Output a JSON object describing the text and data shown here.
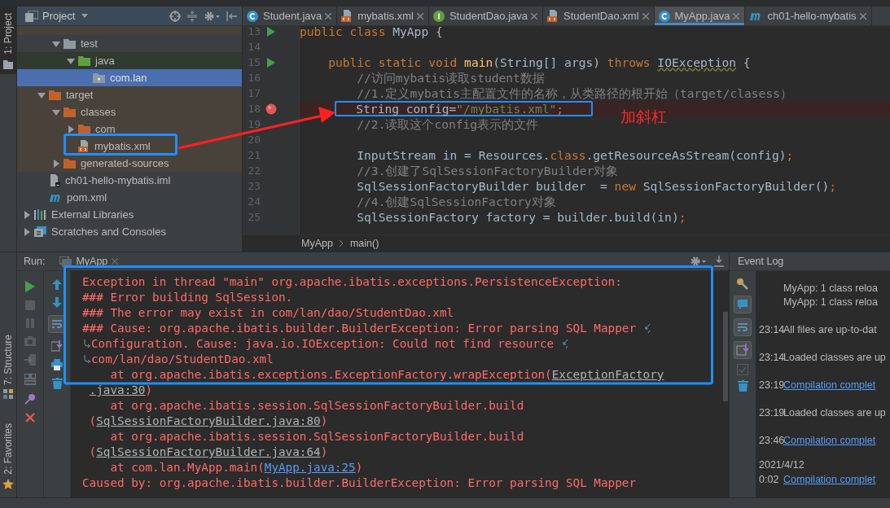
{
  "left_stripe": {
    "top_tab": {
      "label": "1: Project",
      "selected": true
    },
    "bottom_tabs": [
      {
        "label": "7: Structure",
        "kind": "structure"
      },
      {
        "label": "2: Favorites",
        "kind": "favorites"
      }
    ]
  },
  "project_panel": {
    "title": "Project",
    "tree": [
      {
        "children": [
          {
            "children": [
              {
                "label": "test",
                "kind": "folder",
                "expanded": true,
                "selected": false,
                "children": [
                  {
                    "label": "java",
                    "kind": "folder_test",
                    "expanded": true,
                    "selected": false,
                    "children": [
                      {
                        "label": "com.lan",
                        "kind": "package",
                        "selected": true
                      }
                    ]
                  }
                ]
              }
            ]
          },
          {
            "label": "target",
            "kind": "folder_excluded",
            "expanded": true,
            "selected": false,
            "children": [
              {
                "label": "classes",
                "kind": "folder_excluded",
                "expanded": true,
                "selected": false,
                "children": [
                  {
                    "label": "com",
                    "kind": "folder_excluded",
                    "expanded": false,
                    "selected": false
                  },
                  {
                    "label": "mybatis.xml",
                    "kind": "xml",
                    "selected": false
                  }
                ]
              },
              {
                "label": "generated-sources",
                "kind": "folder_excluded",
                "expanded": false,
                "selected": false
              }
            ]
          },
          {
            "label": "ch01-hello-mybatis.iml",
            "kind": "iml",
            "selected": false
          },
          {
            "label": "pom.xml",
            "kind": "maven",
            "selected": false
          }
        ]
      },
      {
        "label": "External Libraries",
        "kind": "libraries",
        "expanded": false,
        "selected": false
      },
      {
        "label": "Scratches and Consoles",
        "kind": "scratches",
        "expanded": false,
        "selected": false
      }
    ]
  },
  "editor": {
    "tabs": [
      {
        "label": "Student.java",
        "kind": "class",
        "selected": false
      },
      {
        "label": "mybatis.xml",
        "kind": "xml",
        "selected": false
      },
      {
        "label": "StudentDao.java",
        "kind": "interface",
        "selected": false
      },
      {
        "label": "StudentDao.xml",
        "kind": "xml",
        "selected": false
      },
      {
        "label": "MyApp.java",
        "kind": "class",
        "selected": true
      },
      {
        "label": "ch01-hello-mybatis",
        "kind": "maven",
        "selected": false
      }
    ],
    "lines": [
      {
        "number": "13",
        "kind": "run",
        "highlighted": false,
        "tokens": [
          {
            "text": "public class ",
            "kind": "keyword"
          },
          {
            "text": "MyApp {",
            "kind": "plain"
          }
        ]
      },
      {
        "number": "14",
        "highlighted": false
      },
      {
        "number": "15",
        "kind": "run",
        "highlighted": false,
        "tokens": [
          {
            "text": "    public static void ",
            "kind": "keyword"
          },
          {
            "text": "main",
            "kind": "method"
          },
          {
            "text": "(String[] args) ",
            "kind": "plain"
          },
          {
            "text": "throws ",
            "kind": "keyword"
          },
          {
            "text": "IOException",
            "kind": "warning"
          },
          {
            "text": " {",
            "kind": "plain"
          }
        ]
      },
      {
        "number": "16",
        "highlighted": false,
        "tokens": [
          {
            "text": "        //访问mybatis读取student数据",
            "kind": "comment"
          }
        ]
      },
      {
        "number": "17",
        "highlighted": false,
        "tokens": [
          {
            "text": "        //1.定义mybatis主配置文件的名称，从类路径的根开始（target/clasess）",
            "kind": "comment"
          }
        ]
      },
      {
        "number": "18",
        "kind": "breakpoint",
        "highlighted": true,
        "boxed": true,
        "tokens": [
          {
            "text": "        String config=",
            "kind": "plain"
          },
          {
            "text": "\"/mybatis.xml\"",
            "kind": "string"
          },
          {
            "text": ";",
            "kind": "keyword"
          }
        ]
      },
      {
        "number": "19",
        "highlighted": false,
        "tokens": [
          {
            "text": "        //2.读取这个config表示的文件",
            "kind": "comment"
          }
        ]
      },
      {
        "number": "20",
        "highlighted": false
      },
      {
        "number": "21",
        "highlighted": false,
        "tokens": [
          {
            "text": "        InputStream in = Resources.",
            "kind": "plain"
          },
          {
            "text": "class",
            "kind": "keyword"
          },
          {
            "text": ".getResourceAsStream(config)",
            "kind": "plain"
          },
          {
            "text": ";",
            "kind": "keyword"
          }
        ]
      },
      {
        "number": "22",
        "highlighted": false,
        "tokens": [
          {
            "text": "        //3.创建了SqlSessionFactoryBuilder对象",
            "kind": "comment"
          }
        ]
      },
      {
        "number": "23",
        "highlighted": false,
        "tokens": [
          {
            "text": "        SqlSessionFactoryBuilder builder  = ",
            "kind": "plain"
          },
          {
            "text": "new ",
            "kind": "keyword"
          },
          {
            "text": "SqlSessionFactoryBuilder()",
            "kind": "plain"
          },
          {
            "text": ";",
            "kind": "keyword"
          }
        ]
      },
      {
        "number": "24",
        "highlighted": false,
        "tokens": [
          {
            "text": "        //4.创建SqlSessionFactory对象",
            "kind": "comment"
          }
        ]
      },
      {
        "number": "25",
        "highlighted": false,
        "tokens": [
          {
            "text": "        SqlSessionFactory factory = builder.build(in)",
            "kind": "plain"
          },
          {
            "text": ";",
            "kind": "keyword"
          }
        ]
      }
    ],
    "breadcrumbs": [
      "MyApp",
      "main()"
    ]
  },
  "annotation": {
    "note": "加斜杠"
  },
  "run_panel": {
    "label": "Run:",
    "tab": "MyApp",
    "console": [
      {
        "segments": [
          {
            "text": "Exception in thread \"main\" org.apache.ibatis.exceptions.PersistenceException:"
          }
        ]
      },
      {
        "segments": [
          {
            "text": "### Error building SqlSession."
          }
        ]
      },
      {
        "segments": [
          {
            "text": "### The error may exist in com/lan/dao/StudentDao.xml"
          }
        ]
      },
      {
        "wrapped": true,
        "segments": [
          {
            "text": "### Cause: org.apache.ibatis.builder.BuilderException: Error parsing SQL Mapper "
          }
        ]
      },
      {
        "continued": true,
        "wrapped": true,
        "segments": [
          {
            "text": "Configuration. Cause: java.io.IOException: Could not find resource "
          }
        ]
      },
      {
        "continued": true,
        "segments": [
          {
            "text": "com/lan/dao/StudentDao.xml"
          }
        ]
      },
      {
        "segments": [
          {
            "text": "    at org.apache.ibatis.exceptions.ExceptionFactory.wrapException("
          },
          {
            "text": "ExceptionFactory",
            "kind": "ref"
          }
        ]
      },
      {
        "indented": true,
        "segments": [
          {
            "text": ".java:30",
            "kind": "ref"
          },
          {
            "text": ")"
          }
        ]
      },
      {
        "segments": [
          {
            "text": "    at org.apache.ibatis.session.SqlSessionFactoryBuilder.build"
          }
        ]
      },
      {
        "indented": true,
        "segments": [
          {
            "text": "("
          },
          {
            "text": "SqlSessionFactoryBuilder.java:80",
            "kind": "ref"
          },
          {
            "text": ")"
          }
        ]
      },
      {
        "segments": [
          {
            "text": "    at org.apache.ibatis.session.SqlSessionFactoryBuilder.build"
          }
        ]
      },
      {
        "indented": true,
        "segments": [
          {
            "text": "("
          },
          {
            "text": "SqlSessionFactoryBuilder.java:64",
            "kind": "ref"
          },
          {
            "text": ")"
          }
        ]
      },
      {
        "segments": [
          {
            "text": "    at com.lan.MyApp.main("
          },
          {
            "text": "MyApp.java:25",
            "kind": "link"
          },
          {
            "text": ")"
          }
        ]
      },
      {
        "segments": [
          {
            "text": "Caused by: org.apache.ibatis.builder.BuilderException: Error parsing SQL Mapper"
          }
        ]
      }
    ]
  },
  "event_log": {
    "title": "Event Log",
    "entries": [
      {
        "text": "MyApp: 1 class reloa",
        "link": false
      },
      {
        "text": "MyApp: 1 class reloa",
        "link": false
      },
      {
        "time": "23:14",
        "text": "All files are up-to-dat",
        "link": false
      },
      {
        "time": "23:14",
        "text": "Loaded classes are up",
        "link": false
      },
      {
        "time": "23:19",
        "text": "Compilation complet",
        "link": true
      },
      {
        "time": "23:19",
        "text": "Loaded classes are up",
        "link": false
      },
      {
        "time": "23:46",
        "text": "Compilation complet",
        "link": true
      },
      {
        "date": "2021/4/12",
        "time": "0:02",
        "text": "Compilation complet",
        "link": true
      }
    ]
  }
}
